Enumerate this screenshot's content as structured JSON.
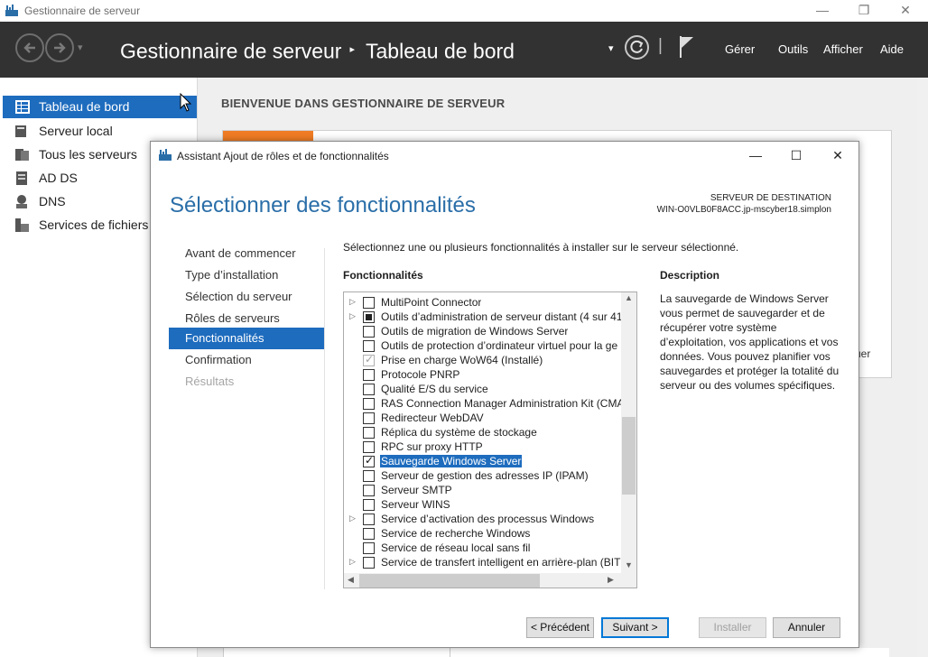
{
  "window": {
    "title": "Gestionnaire de serveur",
    "controls": {
      "minimize": "—",
      "maximize": "❐",
      "close": "✕"
    }
  },
  "header": {
    "app_name": "Gestionnaire de serveur",
    "separator": "▸",
    "location": "Tableau de bord",
    "menu": {
      "manage": "Gérer",
      "tools": "Outils",
      "view": "Afficher",
      "help": "Aide"
    },
    "dropdown_glyph": "▾",
    "divider": "|"
  },
  "sidebar": {
    "items": [
      {
        "label": "Tableau de bord",
        "icon": "dashboard-icon",
        "active": true
      },
      {
        "label": "Serveur local",
        "icon": "server-icon"
      },
      {
        "label": "Tous les serveurs",
        "icon": "servers-icon"
      },
      {
        "label": "AD DS",
        "icon": "ad-ds-icon"
      },
      {
        "label": "DNS",
        "icon": "dns-icon"
      },
      {
        "label": "Services de fichiers e",
        "icon": "file-services-icon"
      }
    ]
  },
  "background": {
    "welcome": "BIENVENUE DANS GESTIONNAIRE DE SERVEUR",
    "fragment": "uer"
  },
  "dialog": {
    "title": "Assistant Ajout de rôles et de fonctionnalités",
    "heading": "Sélectionner des fonctionnalités",
    "destination_label": "SERVEUR DE DESTINATION",
    "destination_server": "WIN-O0VLB0F8ACC.jp-mscyber18.simplon",
    "controls": {
      "minimize": "—",
      "maximize": "☐",
      "close": "✕"
    },
    "steps": [
      {
        "label": "Avant de commencer",
        "state": "normal"
      },
      {
        "label": "Type d’installation",
        "state": "normal"
      },
      {
        "label": "Sélection du serveur",
        "state": "normal"
      },
      {
        "label": "Rôles de serveurs",
        "state": "normal"
      },
      {
        "label": "Fonctionnalités",
        "state": "active"
      },
      {
        "label": "Confirmation",
        "state": "normal"
      },
      {
        "label": "Résultats",
        "state": "disabled"
      }
    ],
    "instruction": "Sélectionnez une ou plusieurs fonctionnalités à installer sur le serveur sélectionné.",
    "features_label": "Fonctionnalités",
    "features": [
      {
        "label": "MultiPoint Connector",
        "expandable": true,
        "state": "unchecked"
      },
      {
        "label": "Outils d’administration de serveur distant (4 sur 41",
        "expandable": true,
        "state": "partial"
      },
      {
        "label": "Outils de migration de Windows Server",
        "expandable": false,
        "state": "unchecked"
      },
      {
        "label": "Outils de protection d’ordinateur virtuel pour la ge",
        "expandable": false,
        "state": "unchecked"
      },
      {
        "label": "Prise en charge WoW64 (Installé)",
        "expandable": false,
        "state": "installed"
      },
      {
        "label": "Protocole PNRP",
        "expandable": false,
        "state": "unchecked"
      },
      {
        "label": "Qualité E/S du service",
        "expandable": false,
        "state": "unchecked"
      },
      {
        "label": "RAS Connection Manager Administration Kit (CMA",
        "expandable": false,
        "state": "unchecked"
      },
      {
        "label": "Redirecteur WebDAV",
        "expandable": false,
        "state": "unchecked"
      },
      {
        "label": "Réplica du système de stockage",
        "expandable": false,
        "state": "unchecked"
      },
      {
        "label": "RPC sur proxy HTTP",
        "expandable": false,
        "state": "unchecked"
      },
      {
        "label": "Sauvegarde Windows Server",
        "expandable": false,
        "state": "checked",
        "selected": true
      },
      {
        "label": "Serveur de gestion des adresses IP (IPAM)",
        "expandable": false,
        "state": "unchecked"
      },
      {
        "label": "Serveur SMTP",
        "expandable": false,
        "state": "unchecked"
      },
      {
        "label": "Serveur WINS",
        "expandable": false,
        "state": "unchecked"
      },
      {
        "label": "Service d’activation des processus Windows",
        "expandable": true,
        "state": "unchecked"
      },
      {
        "label": "Service de recherche Windows",
        "expandable": false,
        "state": "unchecked"
      },
      {
        "label": "Service de réseau local sans fil",
        "expandable": false,
        "state": "unchecked"
      },
      {
        "label": "Service de transfert intelligent en arrière-plan (BITS",
        "expandable": true,
        "state": "unchecked"
      }
    ],
    "description_label": "Description",
    "description_text": "La sauvegarde de Windows Server vous permet de sauvegarder et de récupérer votre système d’exploitation, vos applications et vos données. Vous pouvez planifier vos sauvegardes et protéger la totalité du serveur ou des volumes spécifiques.",
    "buttons": {
      "previous": "< Précédent",
      "next": "Suivant >",
      "install": "Installer",
      "cancel": "Annuler"
    }
  },
  "colors": {
    "header_bg": "#323232",
    "accent": "#1e6cbe",
    "heading": "#2a6ea8",
    "orange": "#f07c24"
  }
}
